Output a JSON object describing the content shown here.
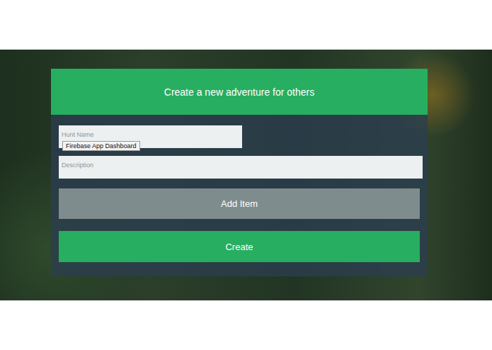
{
  "header": {
    "title": "Create a new adventure for others"
  },
  "fields": [
    {
      "name": "hunt-name",
      "placeholder": "Hunt Name"
    },
    {
      "name": "description",
      "placeholder": "Description"
    }
  ],
  "tooltip": {
    "text": "Firebase App Dashboard"
  },
  "buttons": [
    {
      "label": "Add Item",
      "kind": "secondary"
    },
    {
      "label": "Create",
      "kind": "primary"
    }
  ]
}
